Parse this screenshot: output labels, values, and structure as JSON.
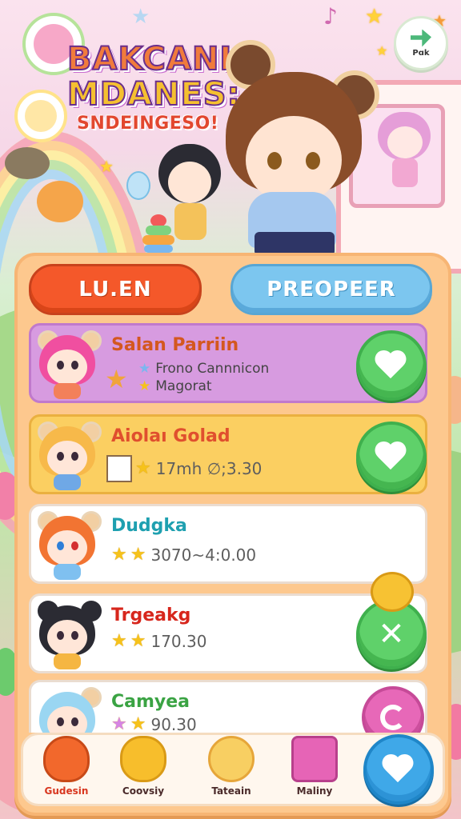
{
  "game": {
    "title_line1": "BAKCANI",
    "title_line2": "MDANES:",
    "subtitle": "SNDEINGESO!",
    "corner_button_label": "Pɑk"
  },
  "tabs": {
    "left_label": "LU.EN",
    "right_label": "PREOPEER"
  },
  "rows": [
    {
      "name": "Salan Parriin",
      "line1": "Frono Cannnicon",
      "line2": "Magorat",
      "name_color": "#d4571f",
      "bg": "#d79be0",
      "border": "#c079cc",
      "action": "heart"
    },
    {
      "name": "Aiolaı Golad",
      "value": "17mh ∅;3.30",
      "stars": 1,
      "name_color": "#e04f2e",
      "bg": "#fbcf61",
      "border": "#eab040",
      "action": "heart"
    },
    {
      "name": "Dudgka",
      "value": "3070~4:0.00",
      "stars": 2,
      "name_color": "#1fa0b0",
      "bg": "#ffffff",
      "border": "#eadcd0",
      "action": "none"
    },
    {
      "name": "Trgeakg",
      "value": "170.30",
      "stars": 2,
      "name_color": "#d7261c",
      "bg": "#ffffff",
      "border": "#eadcd0",
      "action": "close"
    },
    {
      "name": "Camyea",
      "value": "90.30",
      "stars": 2,
      "name_color": "#3aa343",
      "bg": "#ffffff",
      "border": "#eadcd0",
      "action": "swirl"
    }
  ],
  "bottom_nav": [
    {
      "label": "Gudesin",
      "icon": "drop-character-icon"
    },
    {
      "label": "Coovsiy",
      "icon": "yellow-blob-icon"
    },
    {
      "label": "Tateain",
      "icon": "blonde-girl-icon"
    },
    {
      "label": "Maliny",
      "icon": "pink-box-icon"
    }
  ],
  "colors": {
    "panel": "#fdc88e",
    "tab_left": "#f4582a",
    "tab_right": "#7cc6ef",
    "action_green": "#5fd16a",
    "action_blue": "#3fa8e8"
  }
}
